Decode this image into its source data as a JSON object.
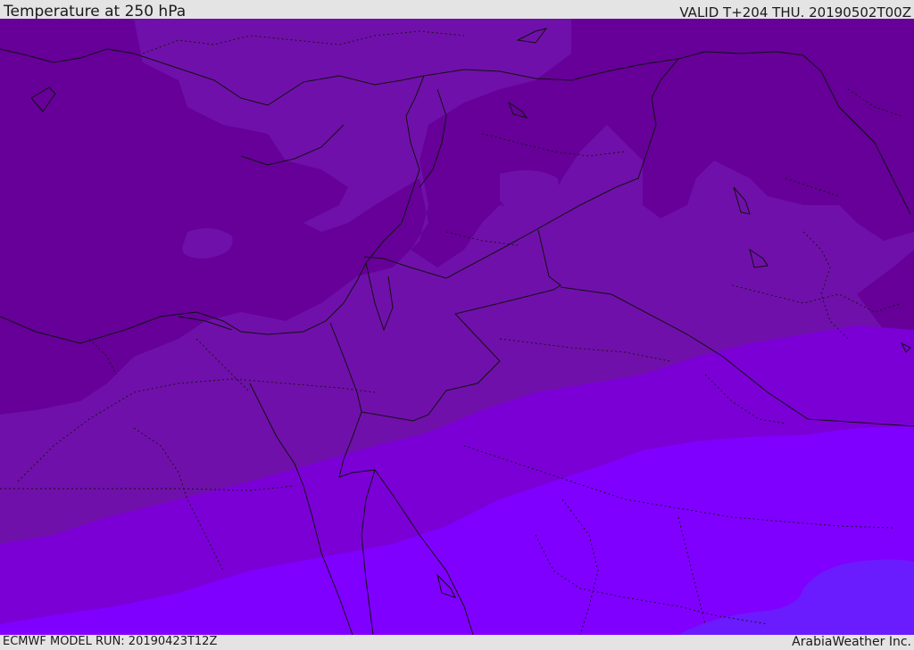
{
  "header": {
    "title": "Temperature at 250 hPa",
    "valid": "VALID T+204 THU. 20190502T00Z"
  },
  "footer": {
    "model_run": "ECMWF MODEL RUN: 20190423T12Z",
    "brand": "ArabiaWeather Inc."
  },
  "colors": {
    "band_darkest": "#660099",
    "band_dark": "#7010aa",
    "band_mid": "#7b00d6",
    "band_bright": "#8000ff",
    "band_blue": "#6a1cff",
    "coastline": "#111111",
    "frame": "#e4e4e4"
  }
}
